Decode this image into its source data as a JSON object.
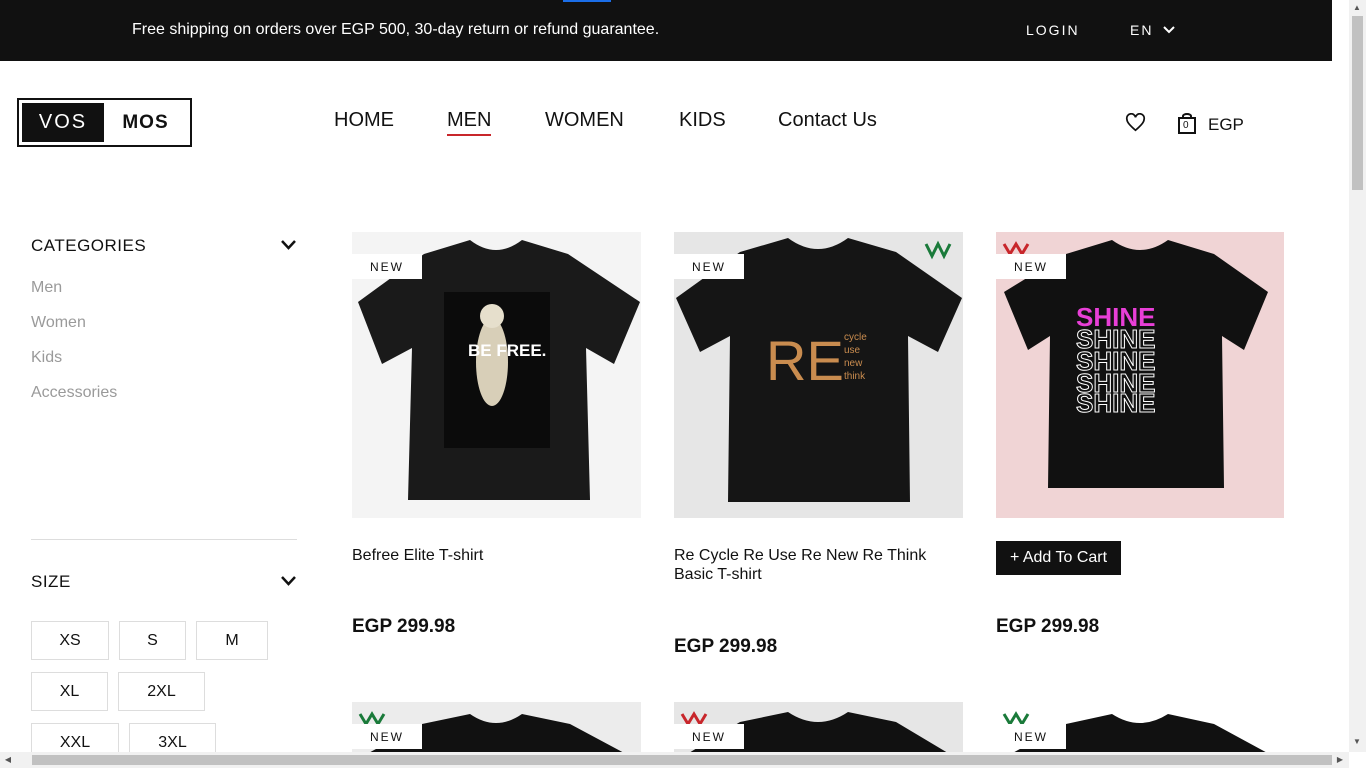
{
  "topbar": {
    "notice": "Free shipping on orders over EGP 500, 30-day return or refund guarantee.",
    "login": "LOGIN",
    "language": "EN"
  },
  "logo": {
    "left": "VOS",
    "right": "MOS"
  },
  "nav": {
    "items": [
      {
        "label": "HOME"
      },
      {
        "label": "MEN"
      },
      {
        "label": "WOMEN"
      },
      {
        "label": "KIDS"
      },
      {
        "label": "Contact Us"
      }
    ],
    "active": "MEN"
  },
  "header": {
    "currency": "EGP",
    "cart_count": "0"
  },
  "sidebar": {
    "categories_title": "CATEGORIES",
    "categories": [
      "Men",
      "Women",
      "Kids",
      "Accessories"
    ],
    "size_title": "SIZE",
    "sizes": [
      "XS",
      "S",
      "M",
      "XL",
      "2XL",
      "XXL",
      "3XL"
    ]
  },
  "products": [
    {
      "badge": "NEW",
      "name": "Befree Elite T-shirt",
      "price": "EGP 299.98"
    },
    {
      "badge": "NEW",
      "name": "Re Cycle Re Use Re New Re Think Basic T-shirt",
      "price": "EGP 299.98"
    },
    {
      "badge": "NEW",
      "name": "",
      "price": "EGP 299.98",
      "add_to_cart": "+ Add To Cart"
    },
    {
      "badge": "NEW"
    },
    {
      "badge": "NEW"
    },
    {
      "badge": "NEW"
    }
  ],
  "print_text": {
    "befree": "BE FREE.",
    "re": "RE",
    "re_words": [
      "cycle",
      "use",
      "new",
      "think"
    ],
    "shine": "SHINE"
  },
  "colors": {
    "accent_underline": "#c8262b",
    "topbar_bg": "#111111",
    "muted_text": "#9a9a9a"
  }
}
